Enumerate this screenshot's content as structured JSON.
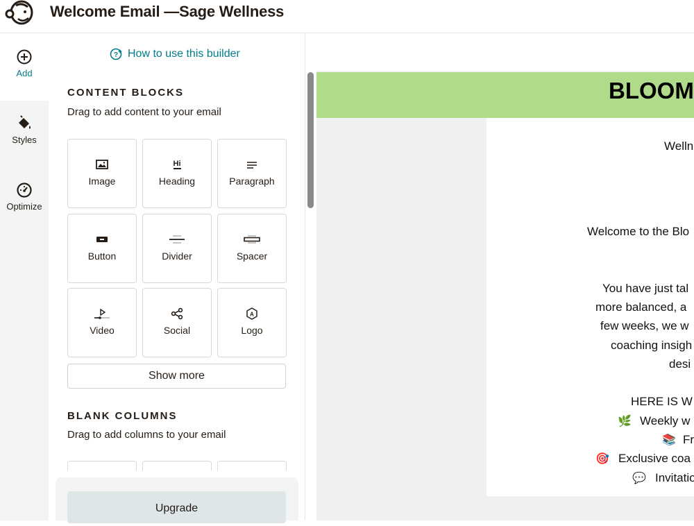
{
  "header": {
    "title": "Welcome Email —Sage Wellness",
    "logo_icon": "mailchimp-logo-icon"
  },
  "rail": {
    "items": [
      {
        "label": "Add",
        "icon": "plus-circle-icon",
        "active": true
      },
      {
        "label": "Styles",
        "icon": "paint-bucket-icon"
      },
      {
        "label": "Optimize",
        "icon": "gauge-icon"
      }
    ]
  },
  "panel": {
    "help_link": "How to use this builder",
    "content_blocks": {
      "title": "CONTENT BLOCKS",
      "subtitle": "Drag to add content to your email",
      "blocks": [
        {
          "label": "Image",
          "icon": "image-icon"
        },
        {
          "label": "Heading",
          "icon": "heading-icon",
          "icon_text": "Hi"
        },
        {
          "label": "Paragraph",
          "icon": "paragraph-icon"
        },
        {
          "label": "Button",
          "icon": "button-icon"
        },
        {
          "label": "Divider",
          "icon": "divider-icon"
        },
        {
          "label": "Spacer",
          "icon": "spacer-icon"
        },
        {
          "label": "Video",
          "icon": "video-icon"
        },
        {
          "label": "Social",
          "icon": "share-icon"
        },
        {
          "label": "Logo",
          "icon": "logo-icon",
          "icon_text": "A"
        }
      ],
      "show_more": "Show more"
    },
    "blank_columns": {
      "title": "BLANK COLUMNS",
      "subtitle": "Drag to add columns to your email"
    },
    "upgrade": "Upgrade"
  },
  "email": {
    "banner_text": "BLOOM",
    "banner_color": "#b0db8a",
    "lines": [
      "Welln",
      "Welcome to the Blo",
      "You have just tal",
      "more balanced, a",
      "few weeks, we w",
      "coaching insigh",
      "desi",
      "HERE IS W",
      "Weekly w",
      "Fr",
      "Exclusive coa",
      "Invitatio"
    ],
    "line_icons": {
      "8": "🌿",
      "9": "📚",
      "10": "🎯",
      "11": "💬"
    }
  },
  "colors": {
    "accent": "#007c89",
    "text": "#241c15"
  }
}
